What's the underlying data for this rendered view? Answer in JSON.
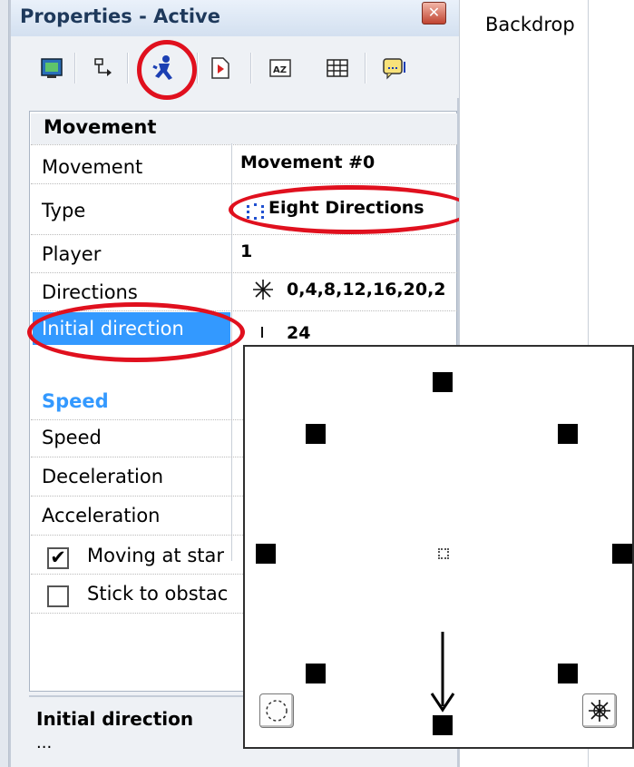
{
  "panel": {
    "title": "Properties - Active",
    "close_glyph": "✕",
    "toolbar": [
      {
        "icon": "settings-display-icon"
      },
      {
        "icon": "display-options-icon"
      },
      {
        "icon": "movement-runner-icon",
        "highlighted": true
      },
      {
        "icon": "runtime-options-icon"
      },
      {
        "icon": "alterable-values-icon"
      },
      {
        "icon": "events-grid-icon"
      },
      {
        "icon": "about-comment-icon"
      }
    ]
  },
  "movement_section": {
    "title": "Movement",
    "rows": [
      {
        "label": "Movement",
        "value": "Movement #0"
      },
      {
        "label": "Type",
        "value": "Eight Directions"
      },
      {
        "label": "Player",
        "value": "1"
      },
      {
        "label": "Directions",
        "value": "0,4,8,12,16,20,2"
      },
      {
        "label": "Initial direction",
        "value": "24"
      }
    ]
  },
  "speed_section": {
    "title": "Speed",
    "rows": [
      {
        "label": "Speed"
      },
      {
        "label": "Deceleration"
      },
      {
        "label": "Acceleration"
      }
    ],
    "checkboxes": [
      {
        "label": "Moving at star",
        "checked": true
      },
      {
        "label": "Stick to obstac",
        "checked": false
      }
    ]
  },
  "description": {
    "title": "Initial direction",
    "text": "..."
  },
  "backdrop_tab": {
    "label": "Backdrop"
  },
  "direction_popup": {
    "selected_direction": "24",
    "icons": [
      "center-dot-icon",
      "down-arrow-icon",
      "all-directions-icon",
      "none-directions-icon"
    ]
  },
  "colors": {
    "title": "#1e395b",
    "selection": "#3399ff",
    "section_speed": "#3399ff",
    "annotation": "#e0101e"
  }
}
